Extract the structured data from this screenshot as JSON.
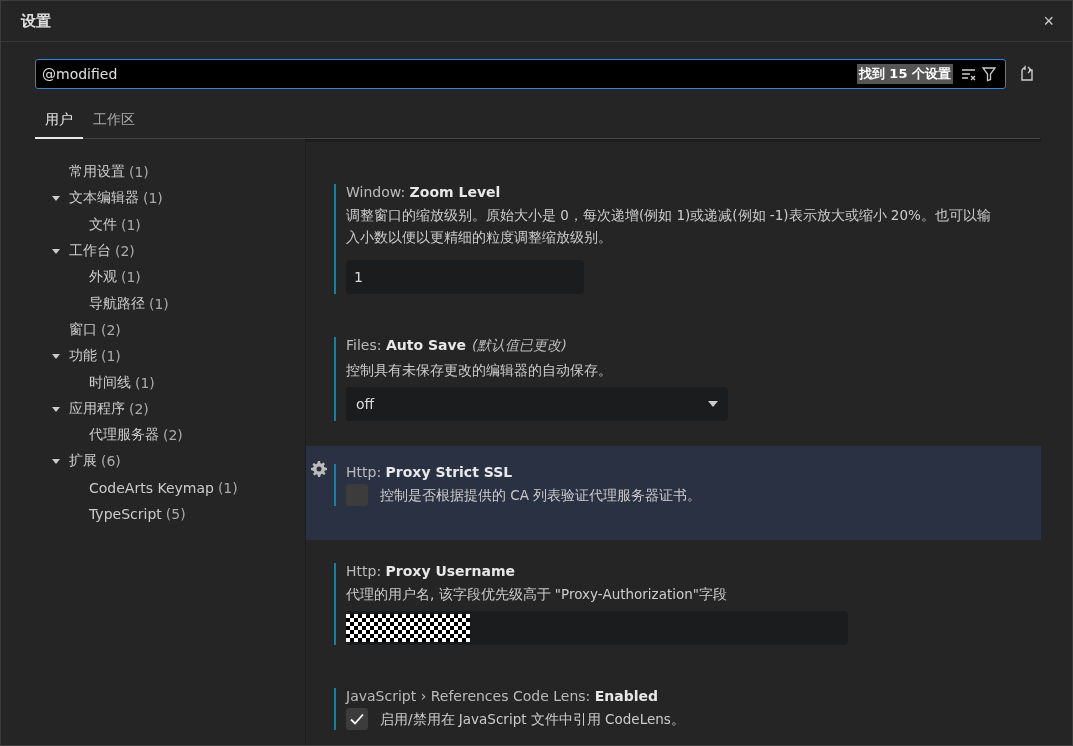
{
  "window": {
    "title": "设置",
    "close": "×"
  },
  "search": {
    "value": "@modified",
    "result_count": "找到 15 个设置"
  },
  "tabs": [
    {
      "label": "用户",
      "selected": true
    },
    {
      "label": "工作区",
      "selected": false
    }
  ],
  "toc": [
    {
      "label": "常用设置",
      "count": "(1)"
    },
    {
      "label": "文本编辑器",
      "count": "(1)",
      "expanded": true,
      "children": [
        {
          "label": "文件",
          "count": "(1)"
        }
      ]
    },
    {
      "label": "工作台",
      "count": "(2)",
      "expanded": true,
      "children": [
        {
          "label": "外观",
          "count": "(1)"
        },
        {
          "label": "导航路径",
          "count": "(1)"
        }
      ]
    },
    {
      "label": "窗口",
      "count": "(2)"
    },
    {
      "label": "功能",
      "count": "(1)",
      "expanded": true,
      "children": [
        {
          "label": "时间线",
          "count": "(1)"
        }
      ]
    },
    {
      "label": "应用程序",
      "count": "(2)",
      "expanded": true,
      "children": [
        {
          "label": "代理服务器",
          "count": "(2)"
        }
      ]
    },
    {
      "label": "扩展",
      "count": "(6)",
      "expanded": true,
      "children": [
        {
          "label": "CodeArts Keymap",
          "count": "(1)"
        },
        {
          "label": "TypeScript",
          "count": "(5)"
        }
      ]
    }
  ],
  "settings": [
    {
      "kind": "text",
      "category": "Window: ",
      "name": "Zoom Level",
      "focused": false,
      "description": "调整窗口的缩放级别。原始大小是 0，每次递增(例如 1)或递减(例如 -1)表示放大或缩小 20%。也可以输入小数以便以更精细的粒度调整缩放级别。",
      "value": "1"
    },
    {
      "kind": "select",
      "category": "Files: ",
      "name": "Auto Save",
      "modified_note": "(默认值已更改)",
      "focused": false,
      "description": "控制具有未保存更改的编辑器的自动保存。",
      "value": "off"
    },
    {
      "kind": "checkbox",
      "category": "Http: ",
      "name": "Proxy Strict SSL",
      "focused": true,
      "description": "控制是否根据提供的 CA 列表验证代理服务器证书。",
      "checked": false
    },
    {
      "kind": "redacted",
      "category": "Http: ",
      "name": "Proxy Username",
      "focused": false,
      "description": "代理的用户名, 该字段优先级高于 \"Proxy-Authorization\"字段"
    },
    {
      "kind": "checkbox",
      "category": "JavaScript › References Code Lens: ",
      "name": "Enabled",
      "focused": false,
      "description": "启用/禁用在 JavaScript 文件中引用 CodeLens。",
      "checked": true
    }
  ]
}
